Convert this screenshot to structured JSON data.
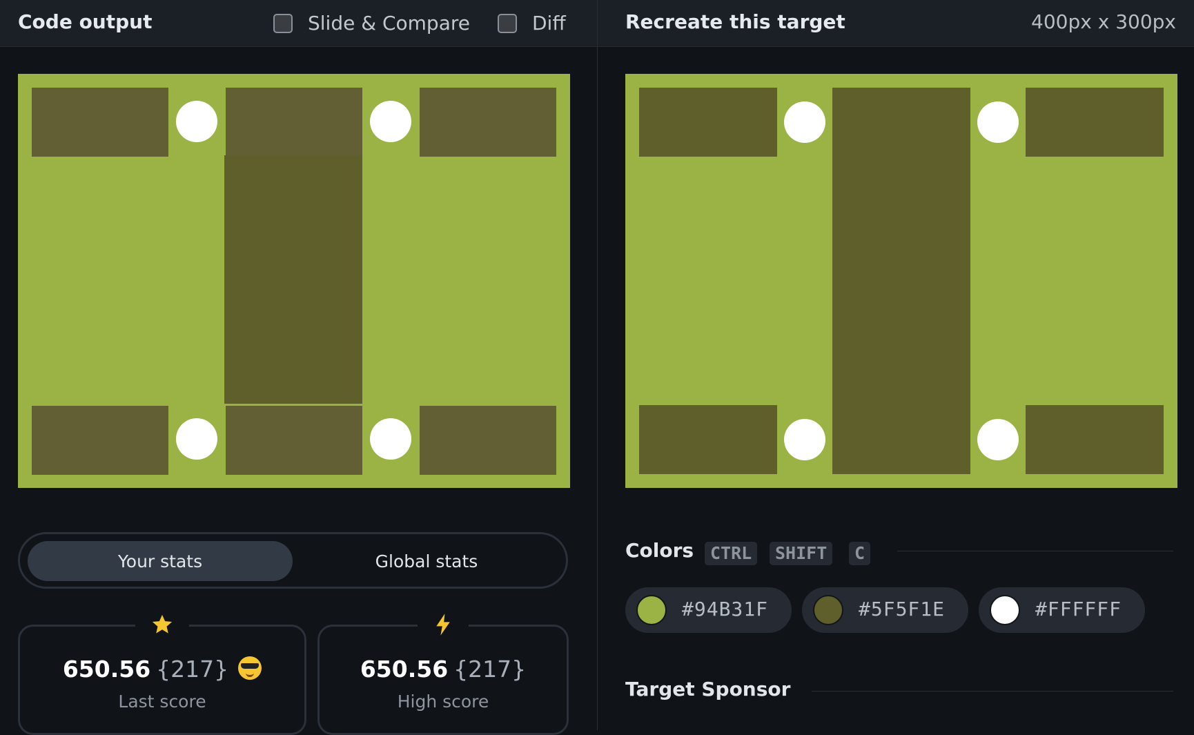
{
  "left_panel": {
    "title": "Code output",
    "slide_compare_label": "Slide & Compare",
    "diff_label": "Diff",
    "colors": {
      "background": "#9BB344",
      "block": "#635F35",
      "bar": "#5F5F2B",
      "dot": "#FFFFFF"
    }
  },
  "right_panel": {
    "title": "Recreate this target",
    "dimensions": "400px x 300px",
    "colors": {
      "background": "#9BB344",
      "block": "#5F5F2B",
      "dot": "#FFFFFF"
    }
  },
  "stats": {
    "tab_your": "Your stats",
    "tab_global": "Global stats",
    "last": {
      "icon": "star-icon",
      "score": "650.56",
      "count": "{217}",
      "label": "Last score"
    },
    "high": {
      "icon": "lightning-icon",
      "score": "650.56",
      "count": "{217}",
      "label": "High score"
    }
  },
  "colors_section": {
    "title": "Colors",
    "keys": [
      "CTRL",
      "SHIFT",
      "C"
    ],
    "swatches": [
      {
        "hex": "#94B31F",
        "display": "#9BB344"
      },
      {
        "hex": "#5F5F1E",
        "display": "#5F5F2B"
      },
      {
        "hex": "#FFFFFF",
        "display": "#FFFFFF"
      }
    ]
  },
  "sponsor_section": {
    "title": "Target Sponsor"
  }
}
